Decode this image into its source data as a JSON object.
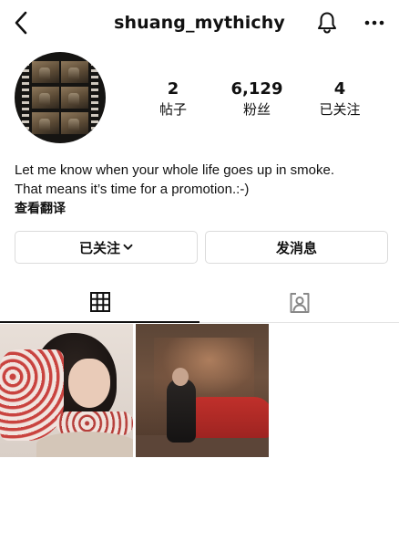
{
  "header": {
    "username": "shuang_mythichy"
  },
  "profile": {
    "stats": {
      "posts": {
        "value": "2",
        "label": "帖子"
      },
      "followers": {
        "value": "6,129",
        "label": "粉丝"
      },
      "following": {
        "value": "4",
        "label": "已关注"
      }
    },
    "bio": {
      "line1": "Let me know when your whole life goes up in smoke.",
      "line2": "That means it’s time for a promotion.:-)",
      "translate": "查看翻译"
    }
  },
  "actions": {
    "following_label": "已关注",
    "message_label": "发消息"
  },
  "icons": {
    "back": "chevron-left-icon",
    "bell": "bell-icon",
    "more": "more-horizontal-icon",
    "dropdown": "chevron-down-icon",
    "grid_tab": "grid-icon",
    "tagged_tab": "tagged-person-icon"
  },
  "colors": {
    "text": "#111111",
    "border": "#dbdbdb",
    "background": "#ffffff"
  }
}
